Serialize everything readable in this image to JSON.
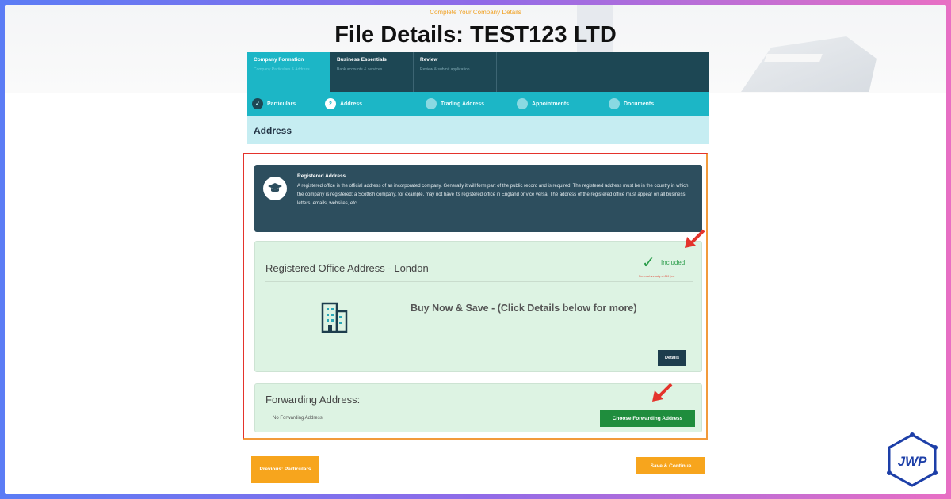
{
  "header": {
    "kicker": "Complete Your Company Details",
    "title": "File Details: TEST123 LTD"
  },
  "wizard_tabs": [
    {
      "title": "Company Formation",
      "subtitle": "Company Particulars & Address",
      "active": true
    },
    {
      "title": "Business Essentials",
      "subtitle": "Bank accounts & services",
      "active": false
    },
    {
      "title": "Review",
      "subtitle": "Review & submit application",
      "active": false
    }
  ],
  "steps": [
    {
      "label": "Particulars",
      "num": "✓",
      "state": "done"
    },
    {
      "label": "Address",
      "num": "2",
      "state": "current"
    },
    {
      "label": "Trading Address",
      "num": "",
      "state": "todo"
    },
    {
      "label": "Appointments",
      "num": "",
      "state": "todo"
    },
    {
      "label": "Documents",
      "num": "",
      "state": "todo"
    }
  ],
  "section_title": "Address",
  "info_box": {
    "icon": "graduation-cap-icon",
    "title": "Registered Address",
    "text": "A registered office is the official address of an incorporated company. Generally it will form part of the public record and is required. The registered address must be in the country in which the company is registered: a Scottish company, for example, may not have its registered office in England or vice versa. The address of the registered office must appear on all business letters, emails, websites, etc."
  },
  "registered_office": {
    "title": "Registered Office Address - London",
    "included_label": "Included",
    "note": "Renewal annually at £49 (ex)",
    "promo": "Buy Now & Save - (Click Details below for more)",
    "details_label": "Details"
  },
  "forwarding": {
    "title": "Forwarding Address:",
    "value": "No Forwarding Address",
    "button_label": "Choose Forwarding Address"
  },
  "footer": {
    "prev_label": "Previous: Particulars",
    "save_label": "Save & Continue"
  },
  "logo_text": "JWP",
  "colors": {
    "accent_teal": "#1cb6c6",
    "dark_navy": "#1d4754",
    "orange": "#f7a51d",
    "green": "#1f8d3d",
    "annotation_red": "#e4332c"
  }
}
